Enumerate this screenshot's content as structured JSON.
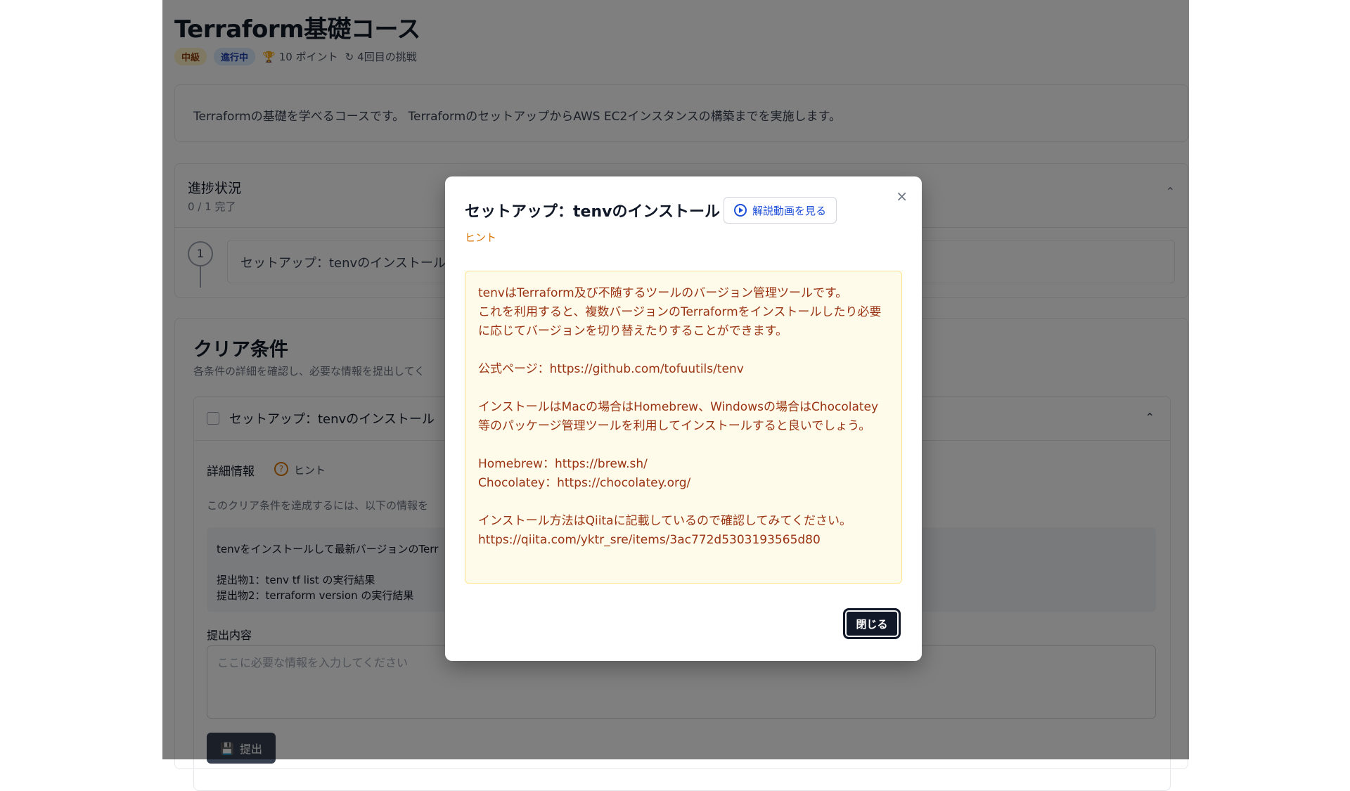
{
  "course": {
    "title": "Terraform基礎コース",
    "level": "中級",
    "status": "進行中",
    "points": "10 ポイント",
    "attempt": "4回目の挑戦",
    "description": "Terraformの基礎を学べるコースです。 TerraformのセットアップからAWS EC2インスタンスの構築までを実施します。"
  },
  "progress": {
    "title": "進捗状況",
    "count": "0 / 1 完了",
    "steps": [
      {
        "number": "1",
        "label": "セットアップ：tenvのインストール"
      }
    ]
  },
  "clear": {
    "title": "クリア条件",
    "subtitle": "各条件の詳細を確認し、必要な情報を提出してく",
    "condition": {
      "title": "セットアップ：tenvのインストール",
      "detail_label": "詳細情報",
      "hint_label": "ヒント",
      "instruction": "このクリア条件を達成するには、以下の情報を",
      "req_line1": "tenvをインストールして最新バージョンのTerr",
      "req_line2": "提出物1：tenv tf list の実行結果",
      "req_line3": "提出物2：terraform version の実行結果",
      "submit_label": "提出内容",
      "textarea_placeholder": "ここに必要な情報を入力してください",
      "submit_button": "提出"
    }
  },
  "modal": {
    "title": "セットアップ：tenvのインストール",
    "video_button": "解説動画を見る",
    "hint_tag": "ヒント",
    "close_button": "閉じる",
    "close_icon": "×",
    "hint_lines": [
      "tenvはTerraform及び不随するツールのバージョン管理ツールです。",
      "これを利用すると、複数バージョンのTerraformをインストールしたり必要に応じてバージョンを切り替えたりすることができます。",
      "",
      "公式ページ：https://github.com/tofuutils/tenv",
      "",
      "インストールはMacの場合はHomebrew、Windowsの場合はChocolatey等のパッケージ管理ツールを利用してインストールすると良いでしょう。",
      "",
      "Homebrew：https://brew.sh/",
      "Chocolatey：https://chocolatey.org/",
      "",
      "インストール方法はQiitaに記載しているので確認してみてください。",
      "https://qiita.com/yktr_sre/items/3ac772d5303193565d80"
    ]
  }
}
